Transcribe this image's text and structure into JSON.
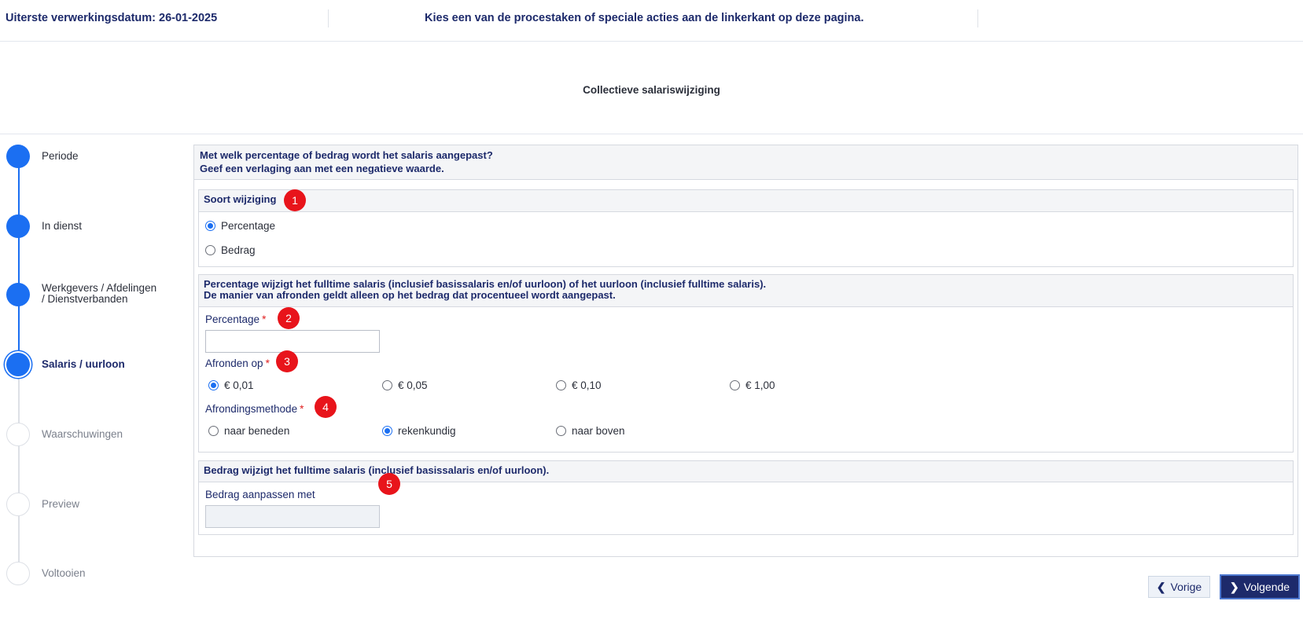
{
  "header": {
    "deadline": "Uiterste verwerkingsdatum: 26-01-2025",
    "message": "Kies een van de procestaken of speciale acties aan de linkerkant op deze pagina."
  },
  "page_title": "Collectieve salariswijziging",
  "stepper": [
    {
      "label": "Periode",
      "state": "done"
    },
    {
      "label": "In dienst",
      "state": "done"
    },
    {
      "label_line1": "Werkgevers / Afdelingen",
      "label_line2": "/ Dienstverbanden",
      "state": "done"
    },
    {
      "label": "Salaris / uurloon",
      "state": "current"
    },
    {
      "label": "Waarschuwingen",
      "state": "todo"
    },
    {
      "label": "Preview",
      "state": "todo"
    },
    {
      "label": "Voltooien",
      "state": "todo"
    }
  ],
  "intro": {
    "line1": "Met welk percentage of bedrag wordt het salaris aangepast?",
    "line2": "Geef een verlaging aan met een negatieve waarde."
  },
  "soort": {
    "title": "Soort wijziging",
    "options": [
      "Percentage",
      "Bedrag"
    ],
    "selected": "Percentage"
  },
  "percentage_section": {
    "title_line1": "Percentage wijzigt het fulltime salaris (inclusief basissalaris en/of uurloon) of het uurloon (inclusief fulltime salaris).",
    "title_line2": "De manier van afronden geldt alleen op het bedrag dat procentueel wordt aangepast.",
    "percentage_label": "Percentage",
    "percentage_value": "",
    "afronden_label": "Afronden op",
    "afronden_options": [
      "€ 0,01",
      "€ 0,05",
      "€ 0,10",
      "€ 1,00"
    ],
    "afronden_selected": "€ 0,01",
    "methode_label": "Afrondingsmethode",
    "methode_options": [
      "naar beneden",
      "rekenkundig",
      "naar boven"
    ],
    "methode_selected": "rekenkundig",
    "required_mark": "*"
  },
  "bedrag_section": {
    "title": "Bedrag wijzigt het fulltime salaris (inclusief basissalaris en/of uurloon).",
    "bedrag_label": "Bedrag aanpassen met",
    "bedrag_value": ""
  },
  "badges": [
    "1",
    "2",
    "3",
    "4",
    "5"
  ],
  "buttons": {
    "prev": "Vorige",
    "next": "Volgende"
  },
  "colors": {
    "primary": "#1b6ff2",
    "navy": "#1d2a6b",
    "badge": "#e8141b"
  }
}
